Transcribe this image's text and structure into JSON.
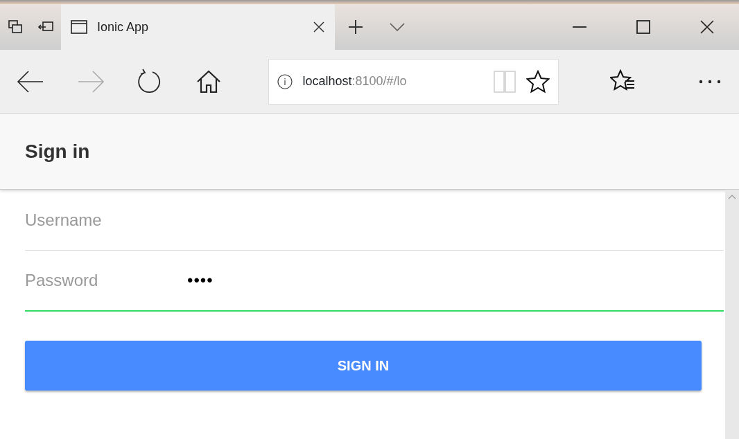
{
  "browser": {
    "tab": {
      "title": "Ionic App",
      "selected": true
    },
    "address": {
      "host": "localhost",
      "path": ":8100/#/lo"
    }
  },
  "header": {
    "title": "Sign in"
  },
  "fields": [
    {
      "label": "Username",
      "kind": "text",
      "focused": false
    },
    {
      "label": "Password",
      "kind": "password",
      "value": "••••",
      "focused": true
    }
  ],
  "button": {
    "label": "SIGN IN"
  }
}
